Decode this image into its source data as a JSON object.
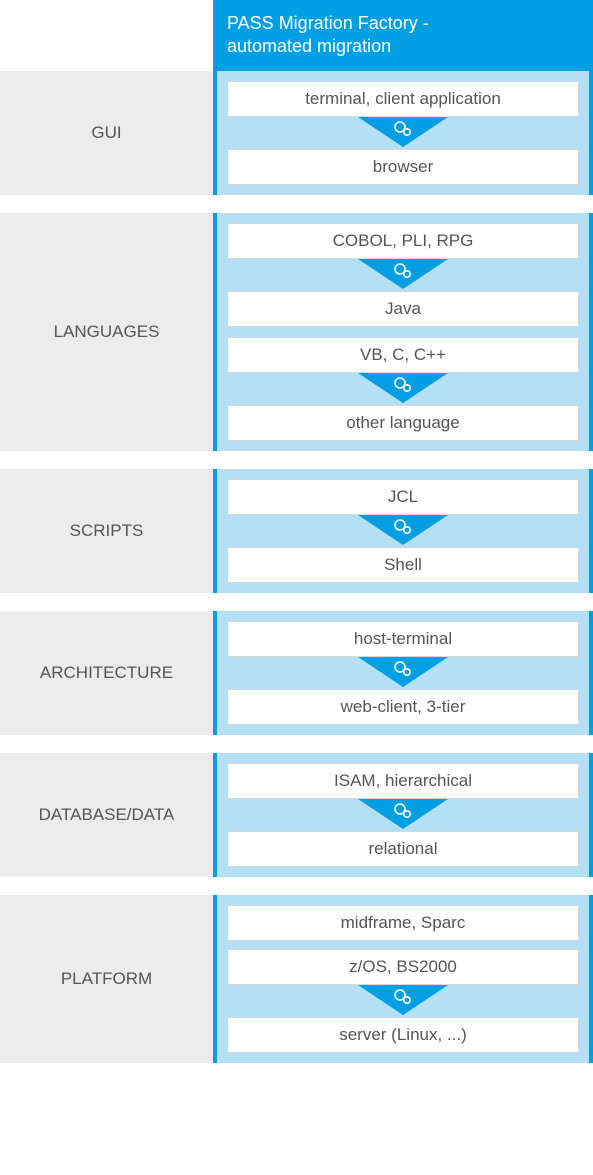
{
  "header": {
    "line1": "PASS Migration Factory -",
    "line2": "automated migration"
  },
  "colors": {
    "primary": "#009fe3",
    "light": "#b3e0f5",
    "gray": "#ececec"
  },
  "sections": [
    {
      "label": "GUI",
      "groups": [
        {
          "from": [
            "terminal, client application"
          ],
          "to": "browser"
        }
      ]
    },
    {
      "label": "LANGUAGES",
      "groups": [
        {
          "from": [
            "COBOL, PLI, RPG"
          ],
          "to": "Java"
        },
        {
          "from": [
            "VB, C, C++"
          ],
          "to": "other language"
        }
      ]
    },
    {
      "label": "SCRIPTS",
      "groups": [
        {
          "from": [
            "JCL"
          ],
          "to": "Shell"
        }
      ]
    },
    {
      "label": "ARCHITECTURE",
      "groups": [
        {
          "from": [
            "host-terminal"
          ],
          "to": "web-client, 3-tier"
        }
      ]
    },
    {
      "label": "DATABASE/DATA",
      "groups": [
        {
          "from": [
            "ISAM, hierarchical"
          ],
          "to": "relational"
        }
      ]
    },
    {
      "label": "PLATFORM",
      "groups": [
        {
          "from": [
            "midframe, Sparc",
            "z/OS, BS2000"
          ],
          "to": "server (Linux, ...)"
        }
      ]
    }
  ]
}
